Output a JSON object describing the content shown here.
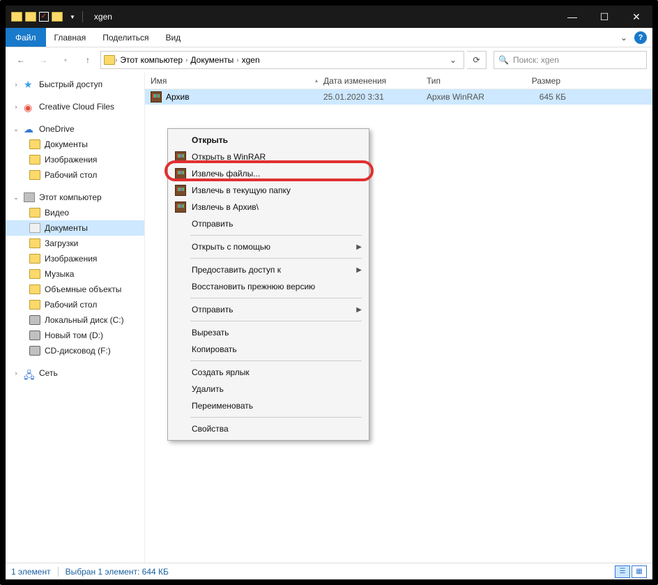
{
  "window": {
    "title": "xgen"
  },
  "ribbon": {
    "file": "Файл",
    "tabs": [
      "Главная",
      "Поделиться",
      "Вид"
    ]
  },
  "breadcrumbs": {
    "items": [
      "Этот компьютер",
      "Документы",
      "xgen"
    ]
  },
  "search": {
    "placeholder": "Поиск: xgen"
  },
  "columns": {
    "name": "Имя",
    "date": "Дата изменения",
    "type": "Тип",
    "size": "Размер"
  },
  "file": {
    "name": "Архив",
    "date": "25.01.2020 3:31",
    "type": "Архив WinRAR",
    "size": "645 КБ"
  },
  "sidebar": {
    "quick": "Быстрый доступ",
    "ccf": "Creative Cloud Files",
    "onedrive": "OneDrive",
    "onedrive_children": [
      "Документы",
      "Изображения",
      "Рабочий стол"
    ],
    "thispc": "Этот компьютер",
    "thispc_children": [
      "Видео",
      "Документы",
      "Загрузки",
      "Изображения",
      "Музыка",
      "Объемные объекты",
      "Рабочий стол",
      "Локальный диск (C:)",
      "Новый том (D:)",
      "CD-дисковод (F:)"
    ],
    "network": "Сеть"
  },
  "context_menu": {
    "open": "Открыть",
    "open_winrar": "Открыть в WinRAR",
    "extract_files": "Извлечь файлы...",
    "extract_here": "Извлечь в текущую папку",
    "extract_to": "Извлечь в Архив\\",
    "send": "Отправить",
    "open_with": "Открыть с помощью",
    "grant_access": "Предоставить доступ к",
    "restore": "Восстановить прежнюю версию",
    "send2": "Отправить",
    "cut": "Вырезать",
    "copy": "Копировать",
    "shortcut": "Создать ярлык",
    "delete": "Удалить",
    "rename": "Переименовать",
    "properties": "Свойства"
  },
  "statusbar": {
    "count": "1 элемент",
    "selection": "Выбран 1 элемент: 644 КБ"
  }
}
